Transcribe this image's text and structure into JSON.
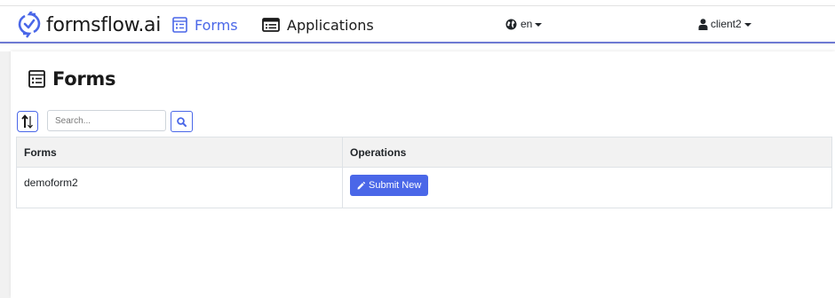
{
  "navbar": {
    "brand": "formsflow.ai",
    "items": [
      {
        "label": "Forms",
        "icon": "forms-icon",
        "active": true
      },
      {
        "label": "Applications",
        "icon": "applications-icon",
        "active": false
      }
    ],
    "language": {
      "icon": "globe-icon",
      "label": "en"
    },
    "user": {
      "icon": "user-icon",
      "label": "client2"
    }
  },
  "page": {
    "title": "Forms",
    "title_icon": "forms-icon"
  },
  "toolbar": {
    "sort_icon": "sort-icon",
    "search_placeholder": "Search...",
    "search_icon": "search-icon"
  },
  "table": {
    "columns": [
      "Forms",
      "Operations"
    ],
    "rows": [
      {
        "form": "demoform2",
        "action_label": "Submit New",
        "action_icon": "pencil-icon"
      }
    ]
  },
  "colors": {
    "accent": "#4a67e8",
    "navbar_border": "#6f7ad3",
    "table_header_bg": "#f2f2f2"
  }
}
